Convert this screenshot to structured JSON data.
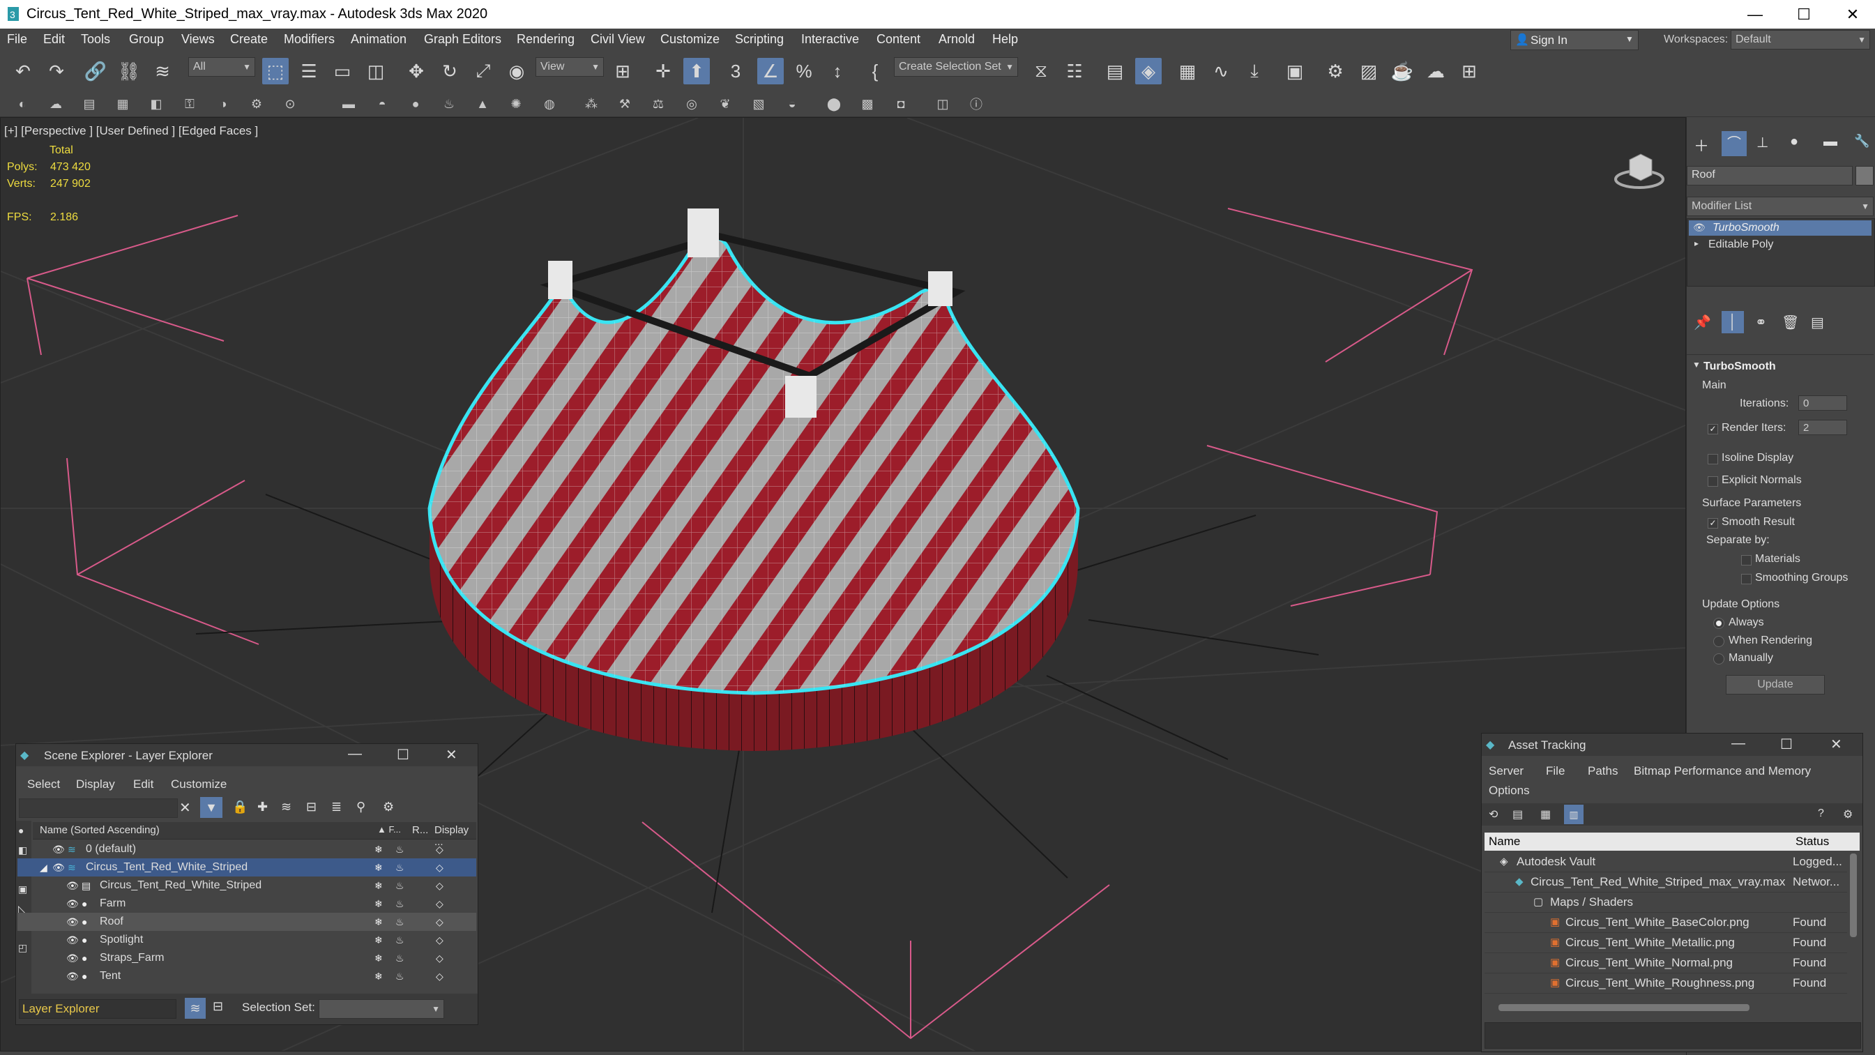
{
  "window": {
    "title": "Circus_Tent_Red_White_Striped_max_vray.max - Autodesk 3ds Max 2020",
    "minimize": "—",
    "maximize": "☐",
    "close": "✕"
  },
  "menu": [
    "File",
    "Edit",
    "Tools",
    "Group",
    "Views",
    "Create",
    "Modifiers",
    "Animation",
    "Graph Editors",
    "Rendering",
    "Civil View",
    "Customize",
    "Scripting",
    "Interactive",
    "Content",
    "Arnold",
    "Help"
  ],
  "account": {
    "sign_in": "Sign In",
    "workspaces_label": "Workspaces:",
    "workspace": "Default"
  },
  "toolbar": {
    "selection_filter": "All",
    "ref_coord": "View",
    "selection_set": "Create Selection Set"
  },
  "viewport": {
    "label": "[+] [Perspective ] [User Defined ] [Edged Faces ]",
    "stats_header": "Total",
    "polys_label": "Polys:",
    "polys": "473 420",
    "verts_label": "Verts:",
    "verts": "247 902",
    "fps_label": "FPS:",
    "fps": "2.186"
  },
  "command_panel": {
    "object_name": "Roof",
    "modifier_list": "Modifier List",
    "stack": [
      "TurboSmooth",
      "Editable Poly"
    ],
    "rollout_title": "TurboSmooth",
    "main": "Main",
    "iterations_label": "Iterations:",
    "iterations": "0",
    "render_iters_label": "Render Iters:",
    "render_iters": "2",
    "isoline": "Isoline Display",
    "explicit_normals": "Explicit Normals",
    "surface_params": "Surface Parameters",
    "smooth_result": "Smooth Result",
    "separate_by": "Separate by:",
    "materials": "Materials",
    "smoothing_groups": "Smoothing Groups",
    "update_options": "Update Options",
    "always": "Always",
    "when_rendering": "When Rendering",
    "manually": "Manually",
    "update": "Update"
  },
  "scene_explorer": {
    "title": "Scene Explorer - Layer Explorer",
    "menus": [
      "Select",
      "Display",
      "Edit",
      "Customize"
    ],
    "col_name": "Name (Sorted Ascending)",
    "col_f": "▲ F...",
    "col_r": "R...",
    "col_display": "Display ...",
    "rows": [
      {
        "label": "0 (default)",
        "indent": 0
      },
      {
        "label": "Circus_Tent_Red_White_Striped",
        "indent": 0
      },
      {
        "label": "Circus_Tent_Red_White_Striped",
        "indent": 1
      },
      {
        "label": "Farm",
        "indent": 1
      },
      {
        "label": "Roof",
        "indent": 1
      },
      {
        "label": "Spotlight",
        "indent": 1
      },
      {
        "label": "Straps_Farm",
        "indent": 1
      },
      {
        "label": "Tent",
        "indent": 1
      }
    ],
    "footer_explorer": "Layer Explorer",
    "selection_set_label": "Selection Set:"
  },
  "asset_tracking": {
    "title": "Asset Tracking",
    "menus": [
      "Server",
      "File",
      "Paths",
      "Bitmap Performance and Memory"
    ],
    "menus2": [
      "Options"
    ],
    "col_name": "Name",
    "col_status": "Status",
    "rows": [
      {
        "name": "Autodesk Vault",
        "status": "Logged..."
      },
      {
        "name": "Circus_Tent_Red_White_Striped_max_vray.max",
        "status": "Networ..."
      },
      {
        "name": "Maps / Shaders",
        "status": ""
      },
      {
        "name": "Circus_Tent_White_BaseColor.png",
        "status": "Found"
      },
      {
        "name": "Circus_Tent_White_Metallic.png",
        "status": "Found"
      },
      {
        "name": "Circus_Tent_White_Normal.png",
        "status": "Found"
      },
      {
        "name": "Circus_Tent_White_Roughness.png",
        "status": "Found"
      }
    ]
  },
  "colors": {
    "accent": "#5a7aa8",
    "selection": "#3d5a8a",
    "tent_red": "#9c1d2a",
    "outline": "#39e4f2"
  }
}
